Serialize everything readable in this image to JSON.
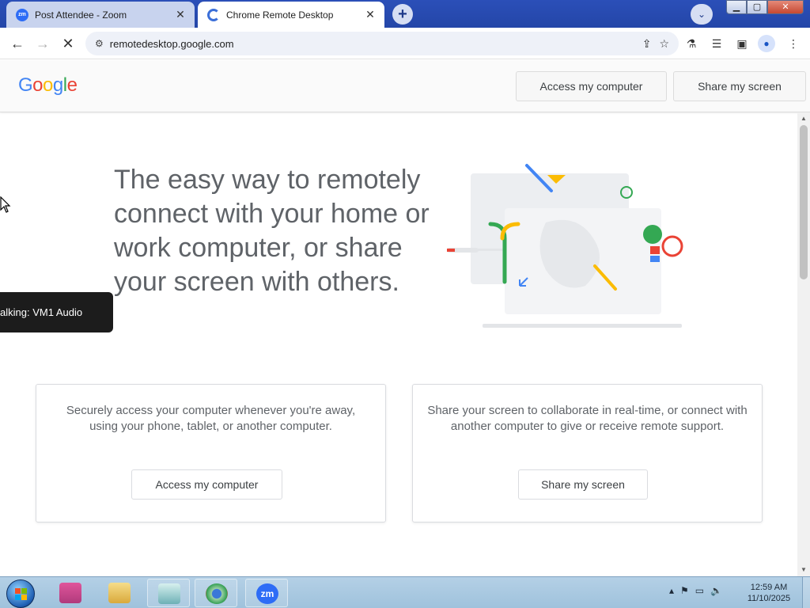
{
  "browser": {
    "tabs": [
      {
        "title": "Post Attendee - Zoom",
        "favicon": "zm",
        "active": false
      },
      {
        "title": "Chrome Remote Desktop",
        "favicon": "",
        "active": true
      }
    ],
    "new_tab": "+",
    "url": "remotedesktop.google.com"
  },
  "page": {
    "logo": [
      "G",
      "o",
      "o",
      "g",
      "l",
      "e"
    ],
    "header_buttons": {
      "access": "Access my computer",
      "share": "Share my screen"
    },
    "hero": "The easy way to remotely connect with your home or work computer, or share your screen with others.",
    "cards": {
      "access": {
        "description": "Securely access your computer whenever you're away, using your phone, tablet, or another computer.",
        "button": "Access my computer"
      },
      "share": {
        "description": "Share your screen to collaborate in real-time, or connect with another computer to give or receive remote support.",
        "button": "Share my screen"
      }
    }
  },
  "overlay": {
    "talking": "alking: VM1 Audio"
  },
  "taskbar": {
    "apps": [
      "zoom-app-icon-pinned",
      "zm"
    ],
    "clock": {
      "time": "12:59 AM",
      "date": "11/10/2025"
    }
  }
}
